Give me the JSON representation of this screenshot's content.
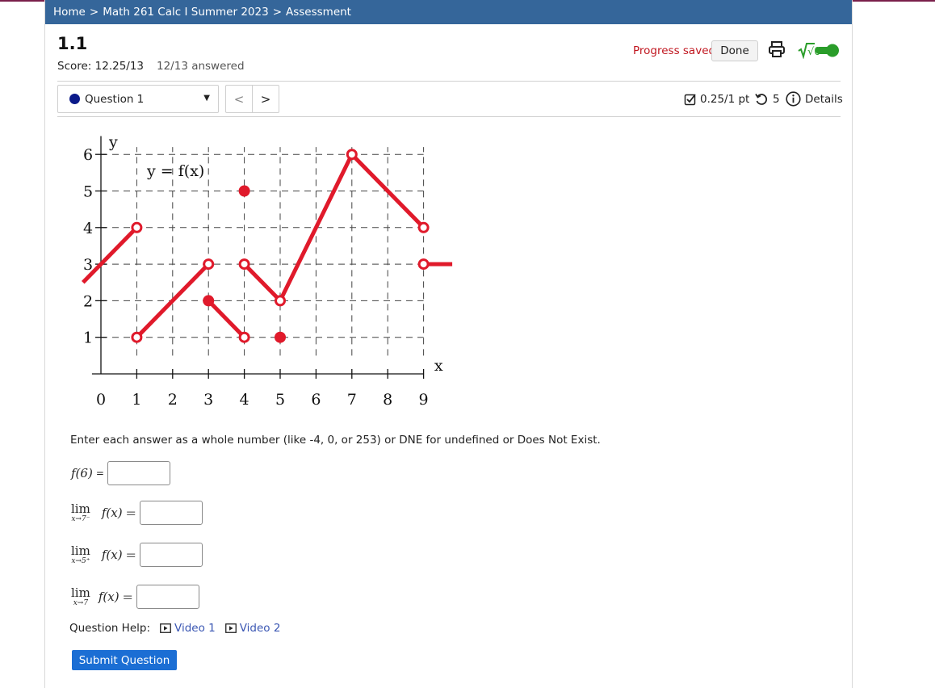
{
  "breadcrumb": {
    "items": [
      "Home",
      "Math 261 Calc I Summer 2023",
      "Assessment"
    ],
    "separator": ">"
  },
  "assessment": {
    "title": "1.1",
    "score": "Score: 12.25/13",
    "answered": "12/13 answered"
  },
  "header_actions": {
    "status": "Progress saved",
    "done_label": "Done",
    "sqrt_toggle_label": "√0"
  },
  "question_nav": {
    "selected": "Question 1",
    "prev": "<",
    "next": ">"
  },
  "question_meta": {
    "points": "0.25/1 pt",
    "attempts": "5",
    "details_label": "Details"
  },
  "graph": {
    "title": "y = f(x)",
    "xlabel": "x",
    "ylabel": "y",
    "x_ticks": [
      "0",
      "1",
      "2",
      "3",
      "4",
      "5",
      "6",
      "7",
      "8",
      "9"
    ],
    "y_ticks": [
      "1",
      "2",
      "3",
      "4",
      "5",
      "6"
    ],
    "line_color": "#e01a2b",
    "segments": [
      [
        [
          -0.5,
          2.5
        ],
        [
          1,
          4
        ]
      ],
      [
        [
          1,
          1
        ],
        [
          3,
          3
        ]
      ],
      [
        [
          3,
          2
        ],
        [
          4,
          1
        ]
      ],
      [
        [
          4,
          3
        ],
        [
          5,
          2
        ],
        [
          7,
          6
        ],
        [
          9,
          4
        ]
      ],
      [
        [
          9,
          3
        ],
        [
          9.8,
          3
        ]
      ]
    ],
    "open_points": [
      [
        1,
        4
      ],
      [
        1,
        1
      ],
      [
        3,
        3
      ],
      [
        4,
        3
      ],
      [
        4,
        1
      ],
      [
        5,
        2
      ],
      [
        7,
        6
      ],
      [
        9,
        4
      ],
      [
        9,
        3
      ]
    ],
    "closed_points": [
      [
        3,
        2
      ],
      [
        4,
        5
      ],
      [
        5,
        1
      ]
    ]
  },
  "question": {
    "instructions": "Enter each answer as a whole number (like -4, 0, or 253) or DNE for undefined or Does Not Exist.",
    "f6_label": "f(6)",
    "f6_eq": "=",
    "lim_word": "lim",
    "fx": "f(x)",
    "eq": "=",
    "limits": [
      {
        "sub": "x→7⁻"
      },
      {
        "sub": "x→5⁺"
      },
      {
        "sub": "x→7"
      }
    ]
  },
  "help": {
    "label": "Question Help:",
    "videos": [
      "Video 1",
      "Video 2"
    ]
  },
  "submit_label": "Submit Question"
}
